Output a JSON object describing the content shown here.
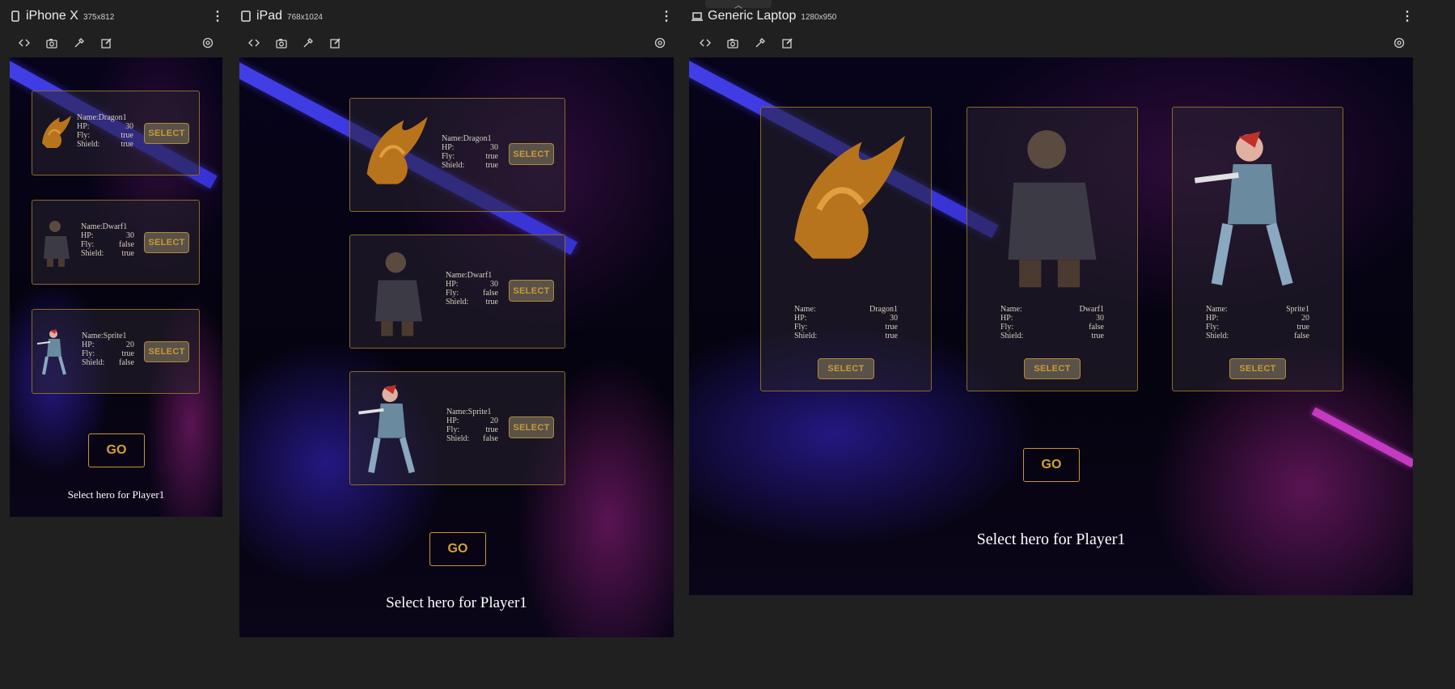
{
  "devices": [
    {
      "name": "iPhone X",
      "size": "375x812"
    },
    {
      "name": "iPad",
      "size": "768x1024"
    },
    {
      "name": "Generic Laptop",
      "size": "1280x950"
    }
  ],
  "heroes": [
    {
      "name": "Dragon1",
      "hp": "30",
      "fly": "true",
      "shield": "true"
    },
    {
      "name": "Dwarf1",
      "hp": "30",
      "fly": "false",
      "shield": "true"
    },
    {
      "name": "Sprite1",
      "hp": "20",
      "fly": "true",
      "shield": "false"
    }
  ],
  "labels": {
    "name_inline": "Name:",
    "name": "Name:",
    "hp": "HP:",
    "fly": "Fly:",
    "shield": "Shield:",
    "select": "SELECT",
    "go": "GO",
    "prompt": "Select hero for Player1"
  },
  "toolbar_icons": [
    "code-icon",
    "camera-icon",
    "eyedropper-icon",
    "edit-icon",
    "refresh-icon"
  ],
  "colors": {
    "accent": "#c8952e",
    "beam": "#4a46ff",
    "pink": "#c43ac2"
  }
}
